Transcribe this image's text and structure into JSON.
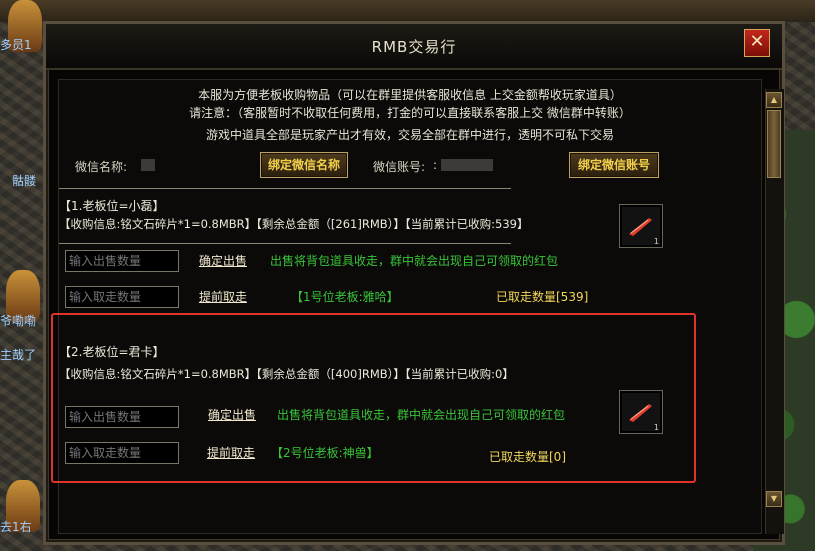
{
  "background": {
    "labels": [
      "多员1",
      "骷髅",
      "爷嘞嘞",
      "主哉了",
      "去1右"
    ]
  },
  "dialog": {
    "title": "RMB交易行",
    "close_label": "✕",
    "notice": [
      "本服为方便老板收购物品（可以在群里提供客服收信息 上交金额帮收玩家道具）",
      "请注意：（客服暂时不收取任何费用，打金的可以直接联系客服上交 微信群中转账）",
      "游戏中道具全部是玩家产出才有效，交易全部在群中进行，透明不可私下交易"
    ],
    "wechat_name_label": "微信名称:",
    "bind_name_button": "绑定微信名称",
    "wechat_account_label": "微信账号:",
    "wechat_account_prefix": ":",
    "bind_account_button": "绑定微信账号"
  },
  "sections": [
    {
      "title": "【1.老板位=小磊】",
      "info": "【收购信息:铭文石碎片*1=0.8MBR】【剩余总金额（[261]RMB）】【当前累计已收购:539】",
      "sell_placeholder": "输入出售数量",
      "confirm_sell": "确定出售",
      "sell_note": "出售将背包道具收走，群中就会出现自己可领取的红包",
      "withdraw_placeholder": "输入取走数量",
      "advance_withdraw": "提前取走",
      "boss_tag": "【1号位老板:雅哈】",
      "withdrawn": "已取走数量[539]",
      "item_qty": "1"
    },
    {
      "title": "【2.老板位=君卡】",
      "info": "【收购信息:铭文石碎片*1=0.8MBR】【剩余总金额（[400]RMB）】【当前累计已收购:0】",
      "sell_placeholder": "输入出售数量",
      "confirm_sell": "确定出售",
      "sell_note": "出售将背包道具收走，群中就会出现自己可领取的红包",
      "withdraw_placeholder": "输入取走数量",
      "advance_withdraw": "提前取走",
      "boss_tag": "【2号位老板:神兽】",
      "withdrawn": "已取走数量[0]",
      "item_qty": "1"
    }
  ],
  "icons": {
    "item": "red-blade-fragment-icon",
    "close": "close-icon",
    "scroll_up": "scroll-up-arrow-icon",
    "scroll_down": "scroll-down-arrow-icon"
  },
  "colors": {
    "gold_text": "#f2cf4a",
    "green_text": "#39c43a",
    "highlight_border": "#e0342a"
  }
}
